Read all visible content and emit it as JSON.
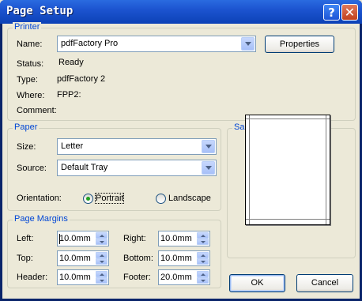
{
  "window": {
    "title": "Page Setup",
    "help_glyph": "?",
    "close_glyph": "✕"
  },
  "printer": {
    "group_label": "Printer",
    "name_label": "Name:",
    "name_value": "pdfFactory Pro",
    "properties_button": "Properties",
    "status_label": "Status:",
    "status_value": "Ready",
    "type_label": "Type:",
    "type_value": "pdfFactory 2",
    "where_label": "Where:",
    "where_value": "FPP2:",
    "comment_label": "Comment:",
    "comment_value": ""
  },
  "paper": {
    "group_label": "Paper",
    "size_label": "Size:",
    "size_value": "Letter",
    "source_label": "Source:",
    "source_value": "Default Tray",
    "orientation_label": "Orientation:",
    "portrait_label": "Portrait",
    "landscape_label": "Landscape",
    "orientation_selected": "Portrait"
  },
  "margins": {
    "group_label": "Page Margins",
    "left_label": "Left:",
    "left_value": "10.0mm",
    "right_label": "Right:",
    "right_value": "10.0mm",
    "top_label": "Top:",
    "top_value": "10.0mm",
    "bottom_label": "Bottom:",
    "bottom_value": "10.0mm",
    "header_label": "Header:",
    "header_value": "10.0mm",
    "footer_label": "Footer:",
    "footer_value": "20.0mm"
  },
  "sample": {
    "group_label": "Sample"
  },
  "footer_buttons": {
    "ok": "OK",
    "cancel": "Cancel"
  },
  "colors": {
    "titlebar": "#0C41B6",
    "group_label": "#0046D5",
    "dialog_bg": "#ECE9D8",
    "radio_dot": "#21A121"
  }
}
